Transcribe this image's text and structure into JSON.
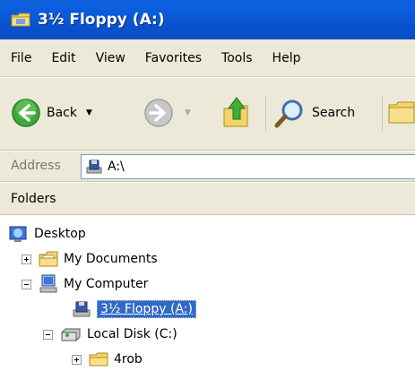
{
  "window": {
    "title": "3½ Floppy (A:)",
    "title_icon": "folder-icon"
  },
  "menu": [
    "File",
    "Edit",
    "View",
    "Favorites",
    "Tools",
    "Help"
  ],
  "toolbar": {
    "back_label": "Back",
    "search_label": "Search"
  },
  "address": {
    "label": "Address",
    "value": "A:\\"
  },
  "folders_label": "Folders",
  "tree": {
    "desktop": "Desktop",
    "my_documents": "My Documents",
    "my_computer": "My Computer",
    "floppy": "3½ Floppy (A:)",
    "local_disk": "Local Disk (C:)",
    "partial": "4rob"
  },
  "colors": {
    "title_blue": "#0a5fd8",
    "selection": "#316ac5",
    "chrome": "#ece9d8"
  }
}
